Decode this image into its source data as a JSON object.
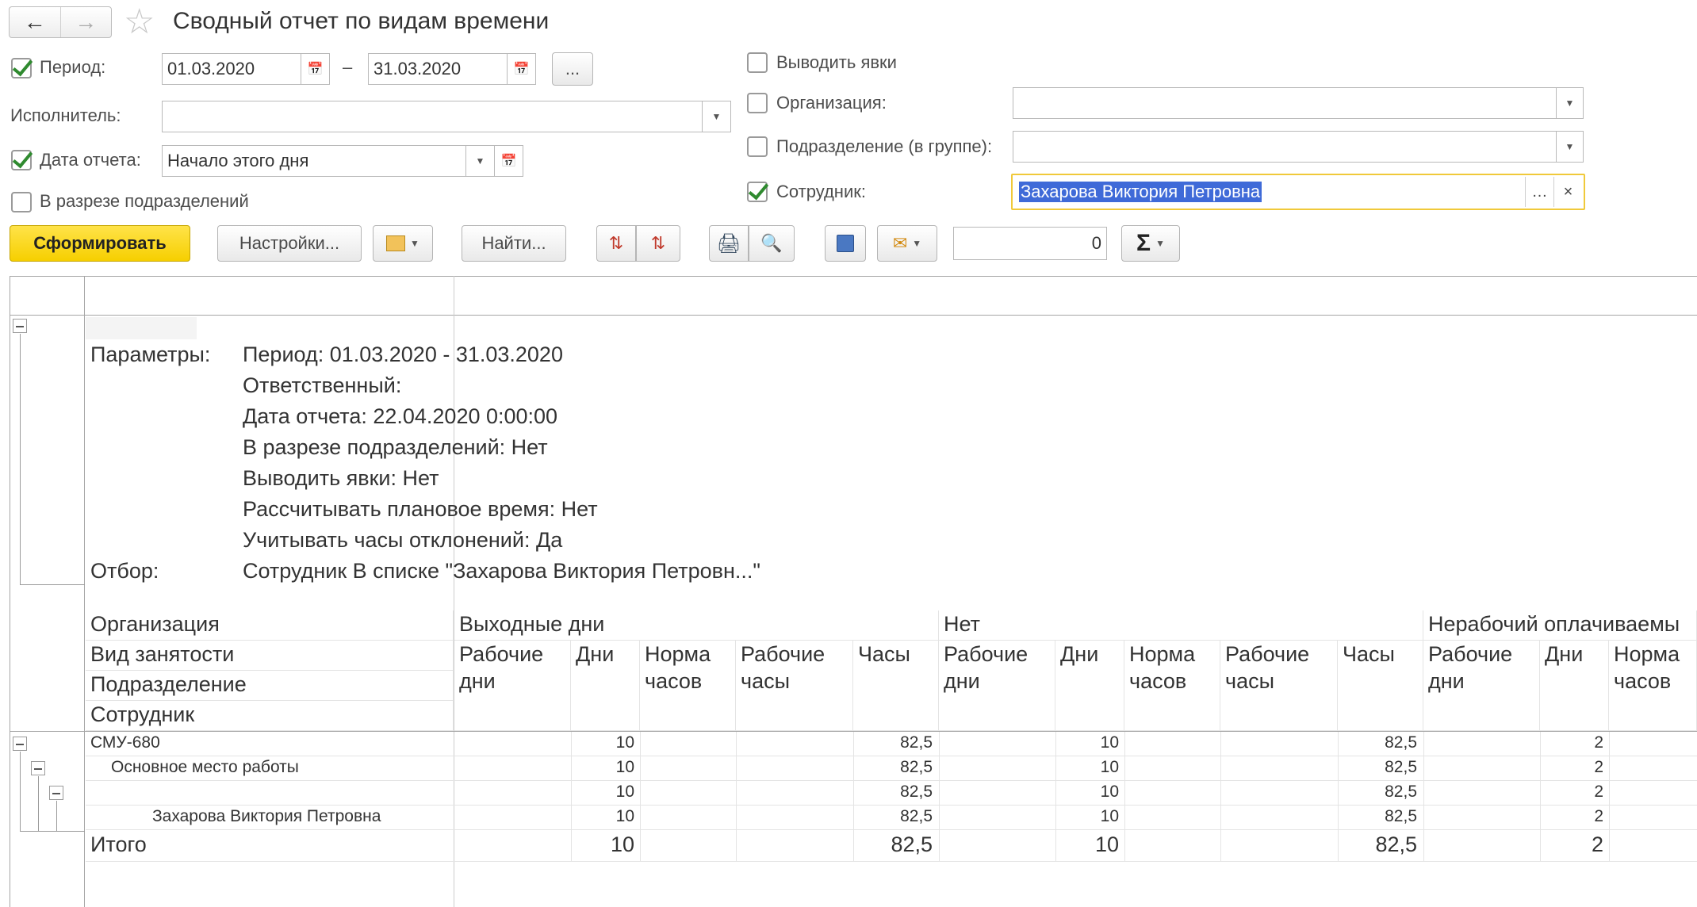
{
  "window": {
    "title": "Сводный отчет по видам времени"
  },
  "form": {
    "period_label": "Период:",
    "period_from": "01.03.2020",
    "period_dash": "–",
    "period_to": "31.03.2020",
    "period_more": "...",
    "executor_label": "Исполнитель:",
    "report_date_label": "Дата отчета:",
    "report_date_value": "Начало этого дня",
    "by_division_label": "В разрезе подразделений",
    "show_attendance_label": "Выводить явки",
    "org_label": "Организация:",
    "subdivision_label": "Подразделение (в группе):",
    "employee_label": "Сотрудник:",
    "employee_value": "Захарова Виктория Петровна"
  },
  "toolbar": {
    "generate": "Сформировать",
    "settings": "Настройки...",
    "find": "Найти...",
    "number_value": "0"
  },
  "report": {
    "params_label": "Параметры:",
    "params": [
      "Период: 01.03.2020 - 31.03.2020",
      "Ответственный:",
      "Дата отчета: 22.04.2020 0:00:00",
      "В разрезе подразделений: Нет",
      "Выводить явки: Нет",
      "Рассчитывать плановое время: Нет",
      "Учитывать часы отклонений: Да"
    ],
    "filter_label": "Отбор:",
    "filter_value": "Сотрудник В списке \"Захарова Виктория Петровн...\"",
    "row_headers": [
      "Организация",
      "Вид занятости",
      "Подразделение",
      "Сотрудник"
    ],
    "groups": [
      "Выходные дни",
      "Нет",
      "Нерабочий оплачиваемы"
    ],
    "sub_headers": [
      "Рабочие дни",
      "Дни",
      "Норма часов",
      "Рабочие часы",
      "Часы",
      "Рабочие дни",
      "Дни",
      "Норма часов",
      "Рабочие часы",
      "Часы",
      "Рабочие дни",
      "Дни",
      "Норма часов"
    ],
    "rows": [
      {
        "label": "СМУ-680",
        "g1_days": "10",
        "g1_hours": "82,5",
        "g2_days": "10",
        "g2_hours": "82,5",
        "g3_days": "2"
      },
      {
        "label": "Основное место работы",
        "g1_days": "10",
        "g1_hours": "82,5",
        "g2_days": "10",
        "g2_hours": "82,5",
        "g3_days": "2"
      },
      {
        "label": "",
        "g1_days": "10",
        "g1_hours": "82,5",
        "g2_days": "10",
        "g2_hours": "82,5",
        "g3_days": "2"
      },
      {
        "label": "Захарова Виктория Петровна",
        "g1_days": "10",
        "g1_hours": "82,5",
        "g2_days": "10",
        "g2_hours": "82,5",
        "g3_days": "2"
      }
    ],
    "total": {
      "label": "Итого",
      "g1_days": "10",
      "g1_hours": "82,5",
      "g2_days": "10",
      "g2_hours": "82,5",
      "g3_days": "2"
    }
  }
}
